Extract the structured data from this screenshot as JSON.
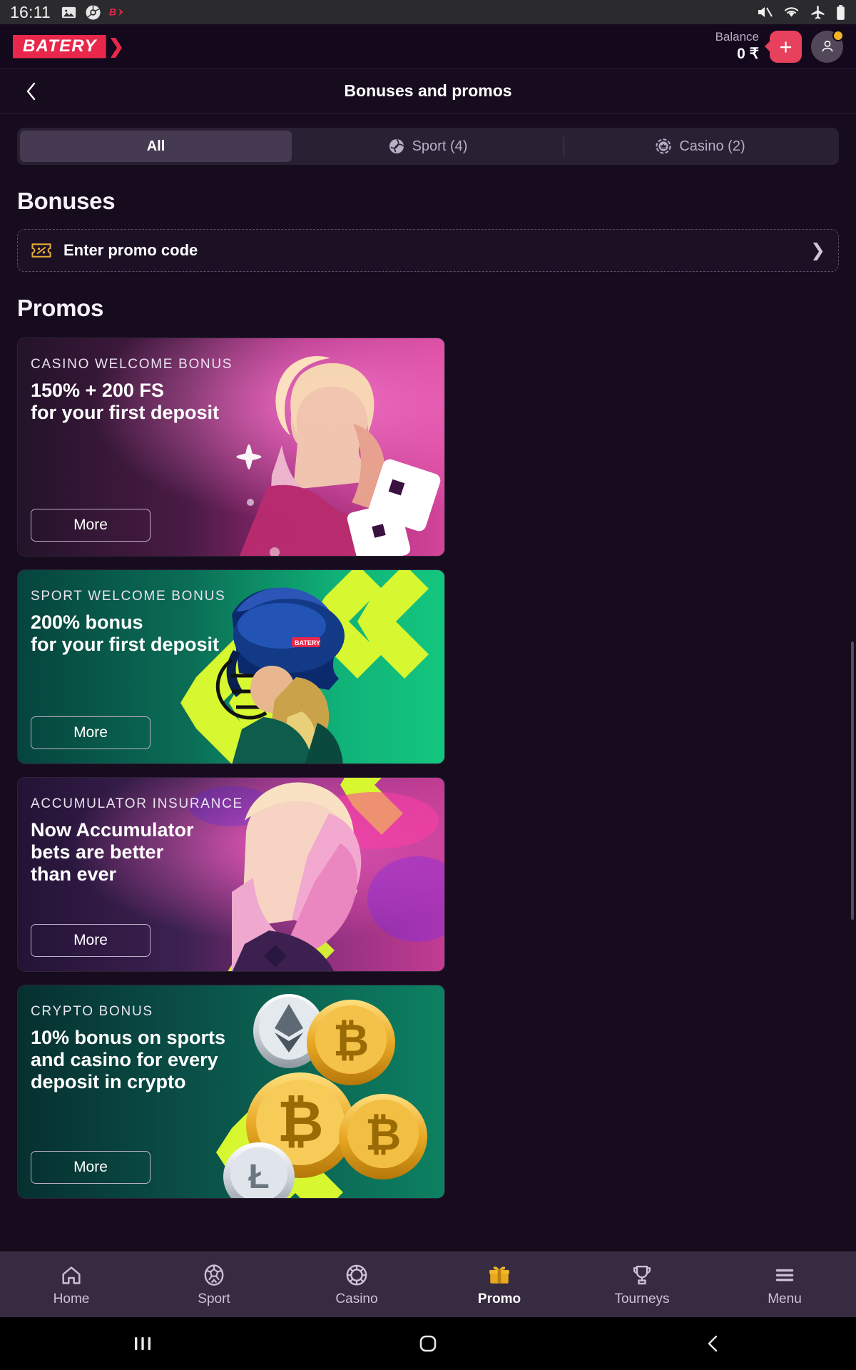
{
  "status_bar": {
    "time": "16:11",
    "left_icons": [
      "gallery-icon",
      "chrome-icon",
      "batery-app-icon"
    ],
    "right_icons": [
      "mute-icon",
      "wifi-icon",
      "airplane-mode-icon",
      "battery-icon"
    ]
  },
  "header": {
    "logo_text": "BATERY",
    "balance_label": "Balance",
    "balance_value": "0 ₹",
    "deposit_label": "+",
    "avatar_icon": "user-avatar-icon"
  },
  "titlebar": {
    "back_icon": "chevron-left-icon",
    "title": "Bonuses and promos"
  },
  "tabs": [
    {
      "id": "all",
      "label": "All",
      "icon": null,
      "active": true
    },
    {
      "id": "sport",
      "label": "Sport (4)",
      "icon": "sport-ball-icon",
      "active": false
    },
    {
      "id": "casino",
      "label": "Casino (2)",
      "icon": "casino-chip-crown-icon",
      "active": false
    }
  ],
  "bonuses": {
    "section_title": "Bonuses",
    "promo_code_label": "Enter promo code",
    "promo_code_icon": "ticket-percent-icon",
    "chevron_icon": "chevron-right-icon"
  },
  "promos": {
    "section_title": "Promos",
    "cards": [
      {
        "id": "casino-welcome-bonus",
        "kicker": "CASINO WELCOME BONUS",
        "title": "150% + 200 FS\nfor your first deposit",
        "button": "More",
        "accent": "#c5318c",
        "art": "casino-woman-neon"
      },
      {
        "id": "sport-welcome-bonus",
        "kicker": "SPORT WELCOME BONUS",
        "title": "200% bonus\nfor your first deposit",
        "button": "More",
        "accent": "#12c07c",
        "art": "cricket-helmet-player"
      },
      {
        "id": "accumulator-insurance",
        "kicker": "ACCUMULATOR INSURANCE",
        "title": "Now Accumulator\nbets are better\nthan ever",
        "button": "More",
        "accent": "#b83a8e",
        "art": "neon-woman-pink"
      },
      {
        "id": "crypto-bonus",
        "kicker": "CRYPTO BONUS",
        "title": "10% bonus on sports\nand casino for every\ndeposit in crypto",
        "button": "More",
        "accent": "#0d7a5e",
        "art": "crypto-coins"
      }
    ]
  },
  "bottom_nav": [
    {
      "id": "home",
      "label": "Home",
      "icon": "home-icon",
      "active": false
    },
    {
      "id": "sport",
      "label": "Sport",
      "icon": "soccer-ball-icon",
      "active": false
    },
    {
      "id": "casino",
      "label": "Casino",
      "icon": "casino-chip-icon",
      "active": false
    },
    {
      "id": "promo",
      "label": "Promo",
      "icon": "gift-icon",
      "active": true
    },
    {
      "id": "tourneys",
      "label": "Tourneys",
      "icon": "trophy-icon",
      "active": false
    },
    {
      "id": "menu",
      "label": "Menu",
      "icon": "hamburger-menu-icon",
      "active": false
    }
  ],
  "system_nav": {
    "recents_icon": "recents-icon",
    "home_icon": "home-circle-icon",
    "back_icon": "back-chevron-icon"
  },
  "colors": {
    "brand_red": "#e8274b",
    "deposit_red": "#e8415e",
    "accent_gold": "#f0b429",
    "page_bg": "#160c1e",
    "nav_bg": "#362b40"
  }
}
